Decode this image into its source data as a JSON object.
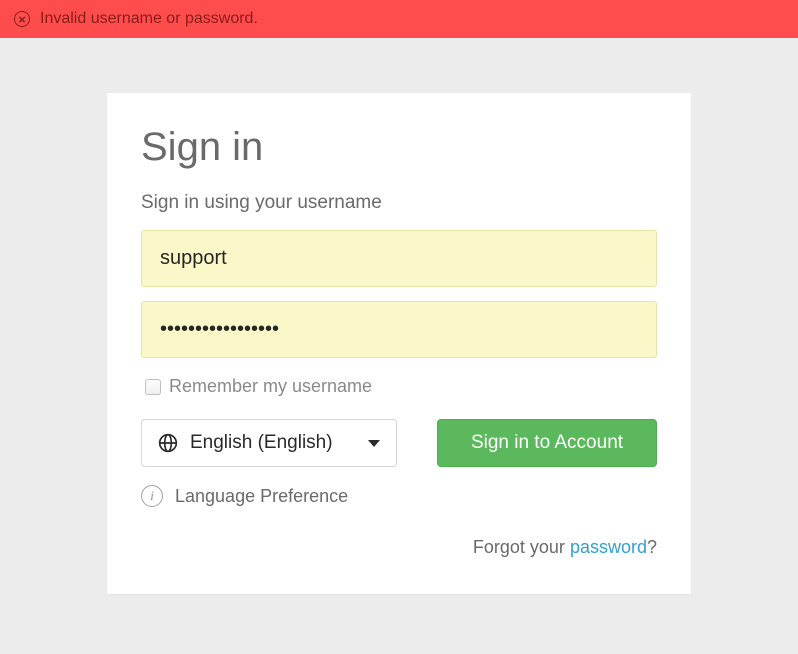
{
  "alert": {
    "message": "Invalid username or password."
  },
  "card": {
    "title": "Sign in",
    "instruction": "Sign in using your username"
  },
  "form": {
    "username_value": "support",
    "password_value": "•••••••••••••••••",
    "remember_label": "Remember my username"
  },
  "language": {
    "selected": "English (English)",
    "preference_label": "Language Preference"
  },
  "buttons": {
    "signin": "Sign in to Account"
  },
  "forgot": {
    "prefix": "Forgot your ",
    "link": "password",
    "suffix": "?"
  }
}
